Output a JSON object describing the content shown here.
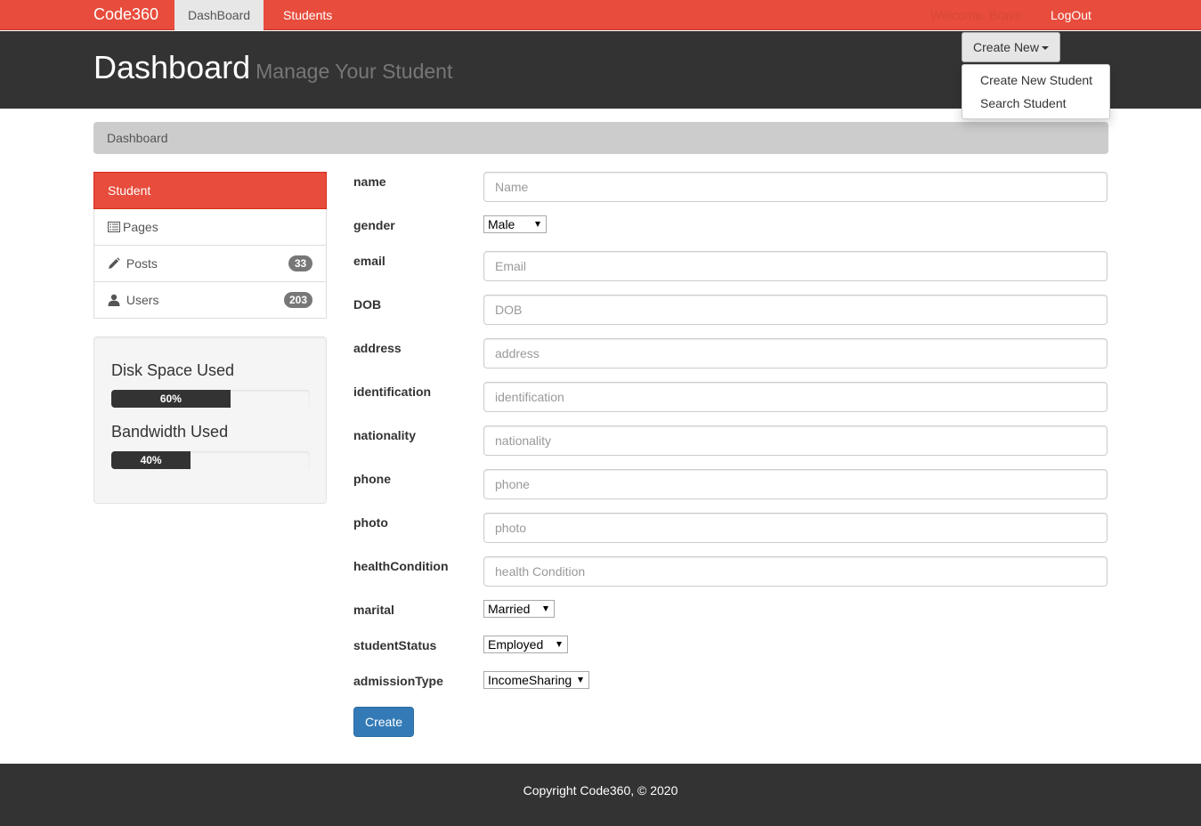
{
  "nav": {
    "brand": "Code360",
    "dashboard": "DashBoard",
    "students": "Students",
    "welcome": "Welcome, Brave",
    "logout": "LogOut"
  },
  "header": {
    "title": "Dashboard",
    "subtitle": "Manage Your Student",
    "create_new": "Create New"
  },
  "dropdown": {
    "items": [
      "Create New Student",
      "Search Student"
    ]
  },
  "breadcrumb": "Dashboard",
  "sidebar": {
    "items": [
      {
        "label": "Student",
        "active": true
      },
      {
        "label": "Pages",
        "icon": "list-icon"
      },
      {
        "label": "Posts",
        "icon": "pencil-icon",
        "badge": "33"
      },
      {
        "label": "Users",
        "icon": "user-icon",
        "badge": "203"
      }
    ]
  },
  "usage": {
    "disk_label": "Disk Space Used",
    "disk_value": 60,
    "disk_text": "60%",
    "bandwidth_label": "Bandwidth Used",
    "bandwidth_value": 40,
    "bandwidth_text": "40%",
    "bar_color": "#333333"
  },
  "form": {
    "name": {
      "label": "name",
      "placeholder": "Name"
    },
    "gender": {
      "label": "gender",
      "value": "Male"
    },
    "email": {
      "label": "email",
      "placeholder": "Email"
    },
    "dob": {
      "label": "DOB",
      "placeholder": "DOB"
    },
    "address": {
      "label": "address",
      "placeholder": "address"
    },
    "identification": {
      "label": "identification",
      "placeholder": "identification"
    },
    "nationality": {
      "label": "nationality",
      "placeholder": "nationality"
    },
    "phone": {
      "label": "phone",
      "placeholder": "phone"
    },
    "photo": {
      "label": "photo",
      "placeholder": "photo"
    },
    "health": {
      "label": "healthCondition",
      "placeholder": "health Condition"
    },
    "marital": {
      "label": "marital",
      "value": "Married"
    },
    "status": {
      "label": "studentStatus",
      "value": "Employed"
    },
    "admission": {
      "label": "admissionType",
      "value": "IncomeSharing"
    },
    "submit": "Create"
  },
  "footer": "Copyright Code360, © 2020",
  "colors": {
    "accent": "#e74c3c",
    "dark": "#333333",
    "primary_button": "#337ab7"
  }
}
